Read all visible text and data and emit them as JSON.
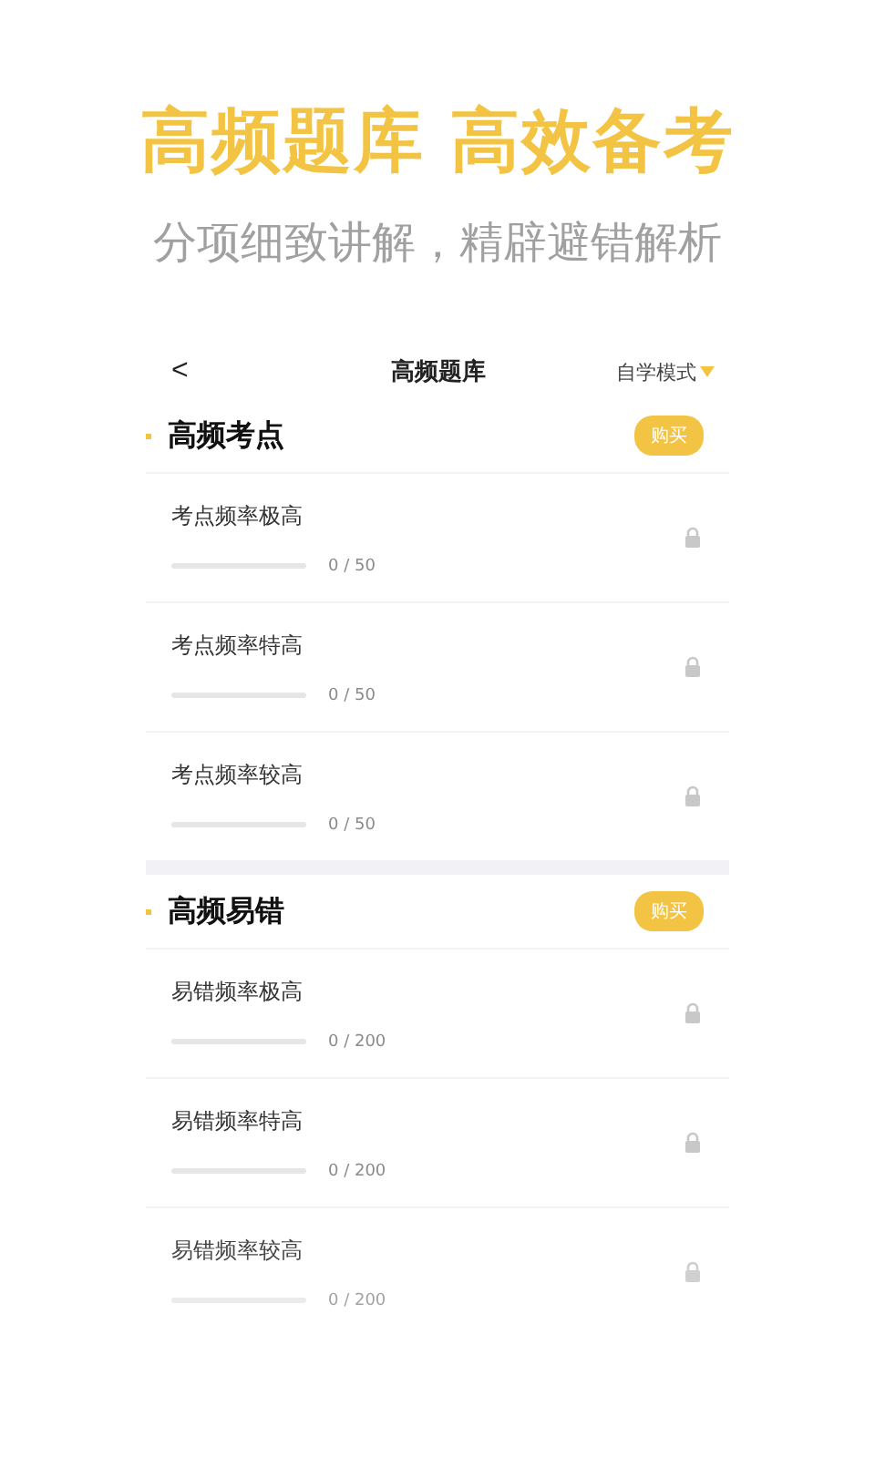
{
  "headline": "高频题库 高效备考",
  "subtitle": "分项细致讲解，精辟避错解析",
  "nav": {
    "back": "<",
    "title": "高频题库",
    "mode": "自学模式"
  },
  "sections": [
    {
      "title": "高频考点",
      "button": "购买",
      "items": [
        {
          "name": "考点频率极高",
          "level": 0,
          "count": "0 / 50",
          "locked": true
        },
        {
          "name": "考点频率特高",
          "level": 0,
          "count": "0 / 50",
          "locked": true
        },
        {
          "name": "考点频率较高",
          "level": 0,
          "count": "0 / 50",
          "locked": true
        }
      ]
    },
    {
      "title": "高频易错",
      "button": "购买",
      "items": [
        {
          "name": "易错频率极高",
          "level": 0,
          "count": "0 / 200",
          "locked": true
        },
        {
          "name": "易错频率特高",
          "level": 0,
          "count": "0 / 200",
          "locked": true
        },
        {
          "name": "易错频率较高",
          "level": 0,
          "count": "0 / 200",
          "locked": true
        }
      ]
    }
  ]
}
